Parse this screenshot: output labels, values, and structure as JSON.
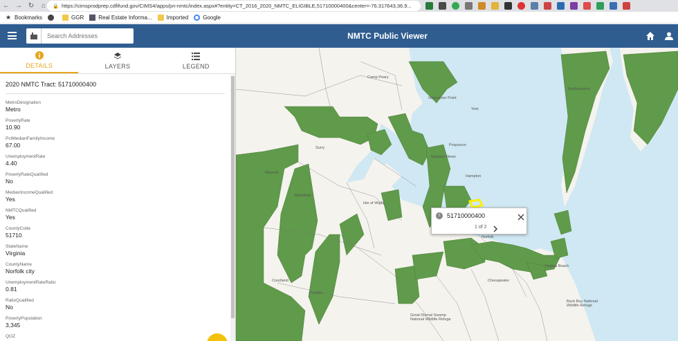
{
  "browser": {
    "url": "https://cimsprodprep.cdfifund.gov/CIMS4/apps/pn-nmtc/index.aspx#?entity=CT_2016_2020_NMTC_ELIGIBLE,51710000400&center=-76.317643,36.9...",
    "bookmarks": [
      {
        "label": "Bookmarks",
        "icon": "star-icon"
      },
      {
        "label": "",
        "icon": "globe-icon"
      },
      {
        "label": "GGR",
        "icon": "folder-icon"
      },
      {
        "label": "Real Estate Informa...",
        "icon": "page-icon"
      },
      {
        "label": "Imported",
        "icon": "folder-icon"
      },
      {
        "label": "Google",
        "icon": "google-icon"
      }
    ]
  },
  "header": {
    "search_placeholder": "Search Addresses",
    "title": "NMTC Public Viewer"
  },
  "tabs": [
    {
      "label": "DETAILS",
      "icon": "info-circle-icon",
      "active": true
    },
    {
      "label": "LAYERS",
      "icon": "layers-icon",
      "active": false
    },
    {
      "label": "LEGEND",
      "icon": "list-icon",
      "active": false
    }
  ],
  "details": {
    "tract_title": "2020 NMTC Tract: 51710000400",
    "fields": [
      {
        "name": "MetroDesignation",
        "value": "Metro"
      },
      {
        "name": "PovertyRate",
        "value": "10.90"
      },
      {
        "name": "PctMedianFamilyIncome",
        "value": "67.00"
      },
      {
        "name": "UnemploymentRate",
        "value": "4.40"
      },
      {
        "name": "PovertyRateQualified",
        "value": "No"
      },
      {
        "name": "MedianIncomeQualified",
        "value": "Yes"
      },
      {
        "name": "NMTCQualified",
        "value": "Yes"
      },
      {
        "name": "CountyCode",
        "value": "51710"
      },
      {
        "name": "StateName",
        "value": "Virginia"
      },
      {
        "name": "CountyName",
        "value": "Norfolk city"
      },
      {
        "name": "UnemploymentRateRatio",
        "value": "0.81"
      },
      {
        "name": "RatioQualified",
        "value": "No"
      },
      {
        "name": "PovertyPopulation",
        "value": "3,345"
      },
      {
        "name": "QOZ",
        "value": ""
      }
    ]
  },
  "map": {
    "colors": {
      "water": "#cfe8f3",
      "land": "#f5f3ee",
      "qualified": "#5f9b4a",
      "highlight": "#ffee00"
    },
    "labels": [
      "Surry",
      "Waverly",
      "Wakefield",
      "Isle of Wight",
      "Courtland",
      "Franklin",
      "Newport News",
      "Hampton",
      "Poquoson",
      "Gloucester Point",
      "Norfolk",
      "Chesapeake",
      "Virginia Beach",
      "Northampton",
      "York",
      "Camp Peary",
      "Back Bay National Wildlife Refuge",
      "Great Dismal Swamp National Wildlife Refuge"
    ]
  },
  "popup": {
    "title": "51710000400",
    "pager": "1 of 2"
  }
}
